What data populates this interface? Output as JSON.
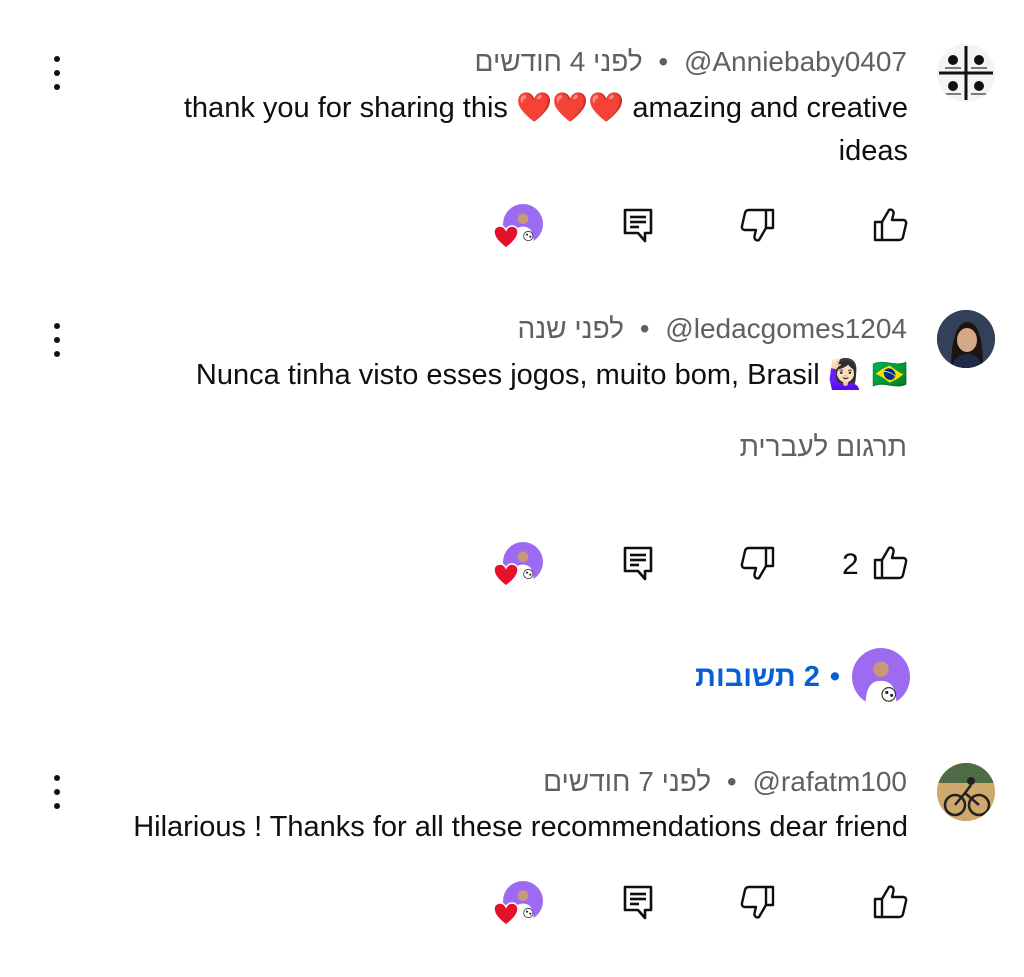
{
  "comments": [
    {
      "handle": "@Anniebaby0407",
      "time": "לפני 4 חודשים",
      "text_line1_a": "thank you for sharing this ",
      "hearts": "❤️❤️❤️",
      "text_line1_b": " amazing and creative",
      "text_line2": "ideas",
      "like_count": ""
    },
    {
      "handle": "@ledacgomes1204",
      "time": "לפני שנה",
      "text": "Nunca tinha visto esses jogos, muito bom, Brasil 🙋🏻‍♀️ 🇧🇷",
      "translate_label": "תרגום לעברית",
      "like_count": "2"
    },
    {
      "handle": "@rafatm100",
      "time": "לפני 7 חודשים",
      "text": "Hilarious ! Thanks for all these recommendations dear friend",
      "like_count": ""
    }
  ],
  "replies": {
    "label": "2 תשובות"
  },
  "separator": "•",
  "colors": {
    "text": "#0f0f0f",
    "meta": "#606060",
    "link": "#065fd4",
    "heart": "#e5112b",
    "creator_avatar_bg": "#9c6bf1"
  },
  "icons": {
    "like": "thumb-up-icon",
    "dislike": "thumb-down-icon",
    "reply": "comment-reply-icon",
    "menu": "more-vert-icon",
    "creator_heart": "creator-heart-icon"
  }
}
